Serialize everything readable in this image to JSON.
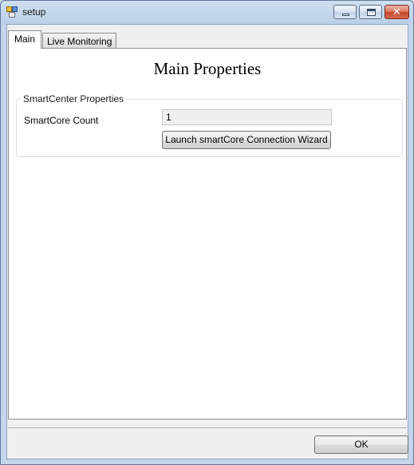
{
  "window": {
    "title": "setup",
    "icon": "app-window-icon",
    "buttons": {
      "minimize": "minimize-icon",
      "maximize": "maximize-icon",
      "close": "close-icon",
      "close_glyph": "✕"
    }
  },
  "tabs": [
    {
      "label": "Main",
      "active": true
    },
    {
      "label": "Live Monitoring",
      "active": false
    }
  ],
  "main": {
    "heading": "Main Properties",
    "group": {
      "legend": "SmartCenter Properties",
      "fields": [
        {
          "label": "SmartCore Count",
          "value": "1"
        }
      ],
      "wizard_button": "Launch smartCore Connection Wizard"
    }
  },
  "footer": {
    "ok_label": "OK"
  },
  "colors": {
    "titlebar": "#c3d6ec",
    "client_bg": "#f0f0f0",
    "close_button": "#c6452b"
  }
}
